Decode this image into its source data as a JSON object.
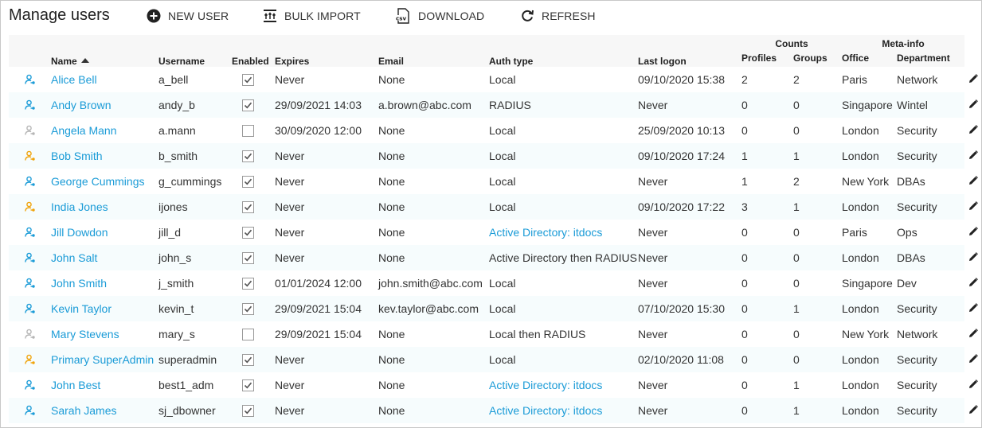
{
  "page": {
    "title": "Manage users"
  },
  "toolbar": {
    "new_user": "NEW USER",
    "bulk_import": "BULK IMPORT",
    "download": "DOWNLOAD",
    "refresh": "REFRESH"
  },
  "colors": {
    "link": "#1a9bd7",
    "user_blue": "#1a9bd7",
    "user_gray": "#b5b5b5",
    "user_orange": "#f0a30a"
  },
  "columns": {
    "name": "Name",
    "username": "Username",
    "enabled": "Enabled",
    "expires": "Expires",
    "email": "Email",
    "auth": "Auth type",
    "last_logon": "Last logon",
    "counts": "Counts",
    "profiles": "Profiles",
    "groups": "Groups",
    "meta": "Meta-info",
    "office": "Office",
    "department": "Department"
  },
  "users": [
    {
      "icon": "blue",
      "name": "Alice Bell",
      "username": "a_bell",
      "enabled": true,
      "expires": "Never",
      "email": "None",
      "auth": "Local",
      "auth_link": false,
      "last_logon": "09/10/2020 15:38",
      "profiles": "2",
      "groups": "2",
      "office": "Paris",
      "department": "Network"
    },
    {
      "icon": "blue",
      "name": "Andy Brown",
      "username": "andy_b",
      "enabled": true,
      "expires": "29/09/2021 14:03",
      "email": "a.brown@abc.com",
      "auth": "RADIUS",
      "auth_link": false,
      "last_logon": "Never",
      "profiles": "0",
      "groups": "0",
      "office": "Singapore",
      "department": "Wintel"
    },
    {
      "icon": "gray",
      "name": "Angela Mann",
      "username": "a.mann",
      "enabled": false,
      "expires": "30/09/2020 12:00",
      "email": "None",
      "auth": "Local",
      "auth_link": false,
      "last_logon": "25/09/2020 10:13",
      "profiles": "0",
      "groups": "0",
      "office": "London",
      "department": "Security"
    },
    {
      "icon": "orange",
      "name": "Bob Smith",
      "username": "b_smith",
      "enabled": true,
      "expires": "Never",
      "email": "None",
      "auth": "Local",
      "auth_link": false,
      "last_logon": "09/10/2020 17:24",
      "profiles": "1",
      "groups": "1",
      "office": "London",
      "department": "Security"
    },
    {
      "icon": "blue",
      "name": "George Cummings",
      "username": "g_cummings",
      "enabled": true,
      "expires": "Never",
      "email": "None",
      "auth": "Local",
      "auth_link": false,
      "last_logon": "Never",
      "profiles": "1",
      "groups": "2",
      "office": "New York",
      "department": "DBAs"
    },
    {
      "icon": "orange",
      "name": "India Jones",
      "username": "ijones",
      "enabled": true,
      "expires": "Never",
      "email": "None",
      "auth": "Local",
      "auth_link": false,
      "last_logon": "09/10/2020 17:22",
      "profiles": "3",
      "groups": "1",
      "office": "London",
      "department": "Security"
    },
    {
      "icon": "blue",
      "name": "Jill Dowdon",
      "username": "jill_d",
      "enabled": true,
      "expires": "Never",
      "email": "None",
      "auth": "Active Directory: itdocs",
      "auth_link": true,
      "last_logon": "Never",
      "profiles": "0",
      "groups": "0",
      "office": "Paris",
      "department": "Ops"
    },
    {
      "icon": "blue",
      "name": "John Salt",
      "username": "john_s",
      "enabled": true,
      "expires": "Never",
      "email": "None",
      "auth": "Active Directory then RADIUS",
      "auth_link": false,
      "last_logon": "Never",
      "profiles": "0",
      "groups": "0",
      "office": "London",
      "department": "DBAs"
    },
    {
      "icon": "blue",
      "name": "John Smith",
      "username": "j_smith",
      "enabled": true,
      "expires": "01/01/2024 12:00",
      "email": "john.smith@abc.com",
      "auth": "Local",
      "auth_link": false,
      "last_logon": "Never",
      "profiles": "0",
      "groups": "0",
      "office": "Singapore",
      "department": "Dev"
    },
    {
      "icon": "blue",
      "name": "Kevin Taylor",
      "username": "kevin_t",
      "enabled": true,
      "expires": "29/09/2021 15:04",
      "email": "kev.taylor@abc.com",
      "auth": "Local",
      "auth_link": false,
      "last_logon": "07/10/2020 15:30",
      "profiles": "0",
      "groups": "1",
      "office": "London",
      "department": "Security"
    },
    {
      "icon": "gray",
      "name": "Mary Stevens",
      "username": "mary_s",
      "enabled": false,
      "expires": "29/09/2021 15:04",
      "email": "None",
      "auth": "Local then RADIUS",
      "auth_link": false,
      "last_logon": "Never",
      "profiles": "0",
      "groups": "0",
      "office": "New York",
      "department": "Network"
    },
    {
      "icon": "orange",
      "name": "Primary SuperAdmin",
      "username": "superadmin",
      "enabled": true,
      "expires": "Never",
      "email": "None",
      "auth": "Local",
      "auth_link": false,
      "last_logon": "02/10/2020 11:08",
      "profiles": "0",
      "groups": "0",
      "office": "London",
      "department": "Security"
    },
    {
      "icon": "blue",
      "name": "John Best",
      "username": "best1_adm",
      "enabled": true,
      "expires": "Never",
      "email": "None",
      "auth": "Active Directory: itdocs",
      "auth_link": true,
      "last_logon": "Never",
      "profiles": "0",
      "groups": "1",
      "office": "London",
      "department": "Security"
    },
    {
      "icon": "blue",
      "name": "Sarah James",
      "username": "sj_dbowner",
      "enabled": true,
      "expires": "Never",
      "email": "None",
      "auth": "Active Directory: itdocs",
      "auth_link": true,
      "last_logon": "Never",
      "profiles": "0",
      "groups": "1",
      "office": "London",
      "department": "Security"
    }
  ]
}
